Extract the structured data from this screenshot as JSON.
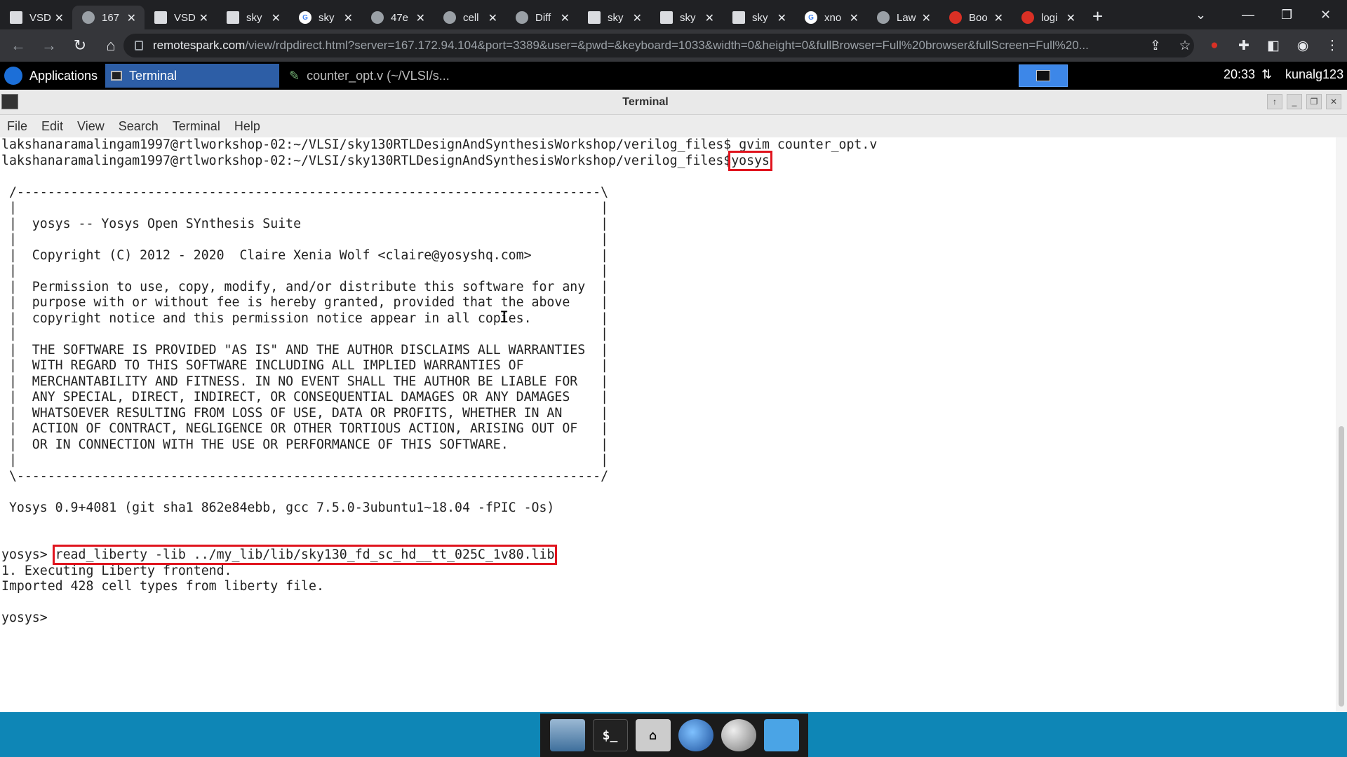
{
  "browser": {
    "tabs": [
      {
        "title": "VSD",
        "icon": "doc-icon"
      },
      {
        "title": "167",
        "icon": "globe-icon",
        "active": true
      },
      {
        "title": "VSD",
        "icon": "doc-icon"
      },
      {
        "title": "sky",
        "icon": "doc-icon"
      },
      {
        "title": "sky",
        "icon": "google-icon"
      },
      {
        "title": "47e",
        "icon": "globe-icon"
      },
      {
        "title": "cell",
        "icon": "globe-icon"
      },
      {
        "title": "Diff",
        "icon": "globe-icon"
      },
      {
        "title": "sky",
        "icon": "doc-icon"
      },
      {
        "title": "sky",
        "icon": "doc-icon"
      },
      {
        "title": "sky",
        "icon": "doc-icon"
      },
      {
        "title": "xno",
        "icon": "google-icon"
      },
      {
        "title": "Law",
        "icon": "globe-icon"
      },
      {
        "title": "Boo",
        "icon": "vivaldi-icon"
      },
      {
        "title": "logi",
        "icon": "gear-icon"
      }
    ],
    "url_domain": "remotespark.com",
    "url_rest": "/view/rdpdirect.html?server=167.172.94.104&port=3389&user=&pwd=&keyboard=1033&width=0&height=0&fullBrowser=Full%20browser&fullScreen=Full%20..."
  },
  "panel": {
    "applications": "Applications",
    "task_active": "Terminal",
    "task_other": "counter_opt.v (~/VLSI/s...",
    "clock": "20:33",
    "user": "kunalg123"
  },
  "terminal": {
    "title": "Terminal",
    "menu": [
      "File",
      "Edit",
      "View",
      "Search",
      "Terminal",
      "Help"
    ],
    "prompt1": "lakshanaramalingam1997@rtlworkshop-02:~/VLSI/sky130RTLDesignAndSynthesisWorkshop/verilog_files$ ",
    "cmd1": "gvim counter_opt.v",
    "prompt2": "lakshanaramalingam1997@rtlworkshop-02:~/VLSI/sky130RTLDesignAndSynthesisWorkshop/verilog_files$",
    "cmd2": "yosys",
    "banner": " /----------------------------------------------------------------------------\\\n |                                                                            |\n |  yosys -- Yosys Open SYnthesis Suite                                       |\n |                                                                            |\n |  Copyright (C) 2012 - 2020  Claire Xenia Wolf <claire@yosyshq.com>         |\n |                                                                            |\n |  Permission to use, copy, modify, and/or distribute this software for any  |\n |  purpose with or without fee is hereby granted, provided that the above    |\n |  copyright notice and this permission notice appear in all copies.         |\n |                                                                            |\n |  THE SOFTWARE IS PROVIDED \"AS IS\" AND THE AUTHOR DISCLAIMS ALL WARRANTIES  |\n |  WITH REGARD TO THIS SOFTWARE INCLUDING ALL IMPLIED WARRANTIES OF          |\n |  MERCHANTABILITY AND FITNESS. IN NO EVENT SHALL THE AUTHOR BE LIABLE FOR   |\n |  ANY SPECIAL, DIRECT, INDIRECT, OR CONSEQUENTIAL DAMAGES OR ANY DAMAGES    |\n |  WHATSOEVER RESULTING FROM LOSS OF USE, DATA OR PROFITS, WHETHER IN AN     |\n |  ACTION OF CONTRACT, NEGLIGENCE OR OTHER TORTIOUS ACTION, ARISING OUT OF   |\n |  OR IN CONNECTION WITH THE USE OR PERFORMANCE OF THIS SOFTWARE.            |\n |                                                                            |\n \\----------------------------------------------------------------------------/",
    "version": " Yosys 0.9+4081 (git sha1 862e84ebb, gcc 7.5.0-3ubuntu1~18.04 -fPIC -Os)",
    "prompt3": "yosys> ",
    "cmd3": "read_liberty -lib ../my_lib/lib/sky130_fd_sc_hd__tt_025C_1v80.lib",
    "out1": "1. Executing Liberty frontend.",
    "out2": "Imported 428 cell types from liberty file.",
    "prompt4": "yosys> "
  },
  "colors": {
    "highlight": "#e0141e",
    "dock_bg": "#0e86b6"
  }
}
